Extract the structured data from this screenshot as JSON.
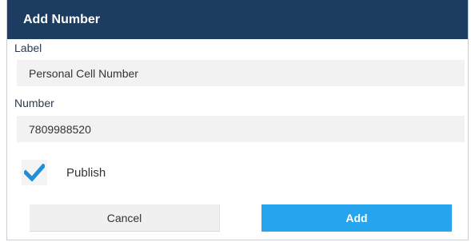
{
  "dialog": {
    "title": "Add Number"
  },
  "form": {
    "label_field": {
      "label": "Label",
      "value": "Personal Cell Number"
    },
    "number_field": {
      "label": "Number",
      "value": "7809988520"
    },
    "publish": {
      "label": "Publish",
      "checked": true,
      "check_icon": "checkmark-icon"
    }
  },
  "buttons": {
    "cancel_label": "Cancel",
    "add_label": "Add"
  },
  "colors": {
    "titlebar": "#1c3c61",
    "accent": "#27a4ee",
    "input_bg": "#f2f2f2",
    "check": "#1e8fd8"
  }
}
